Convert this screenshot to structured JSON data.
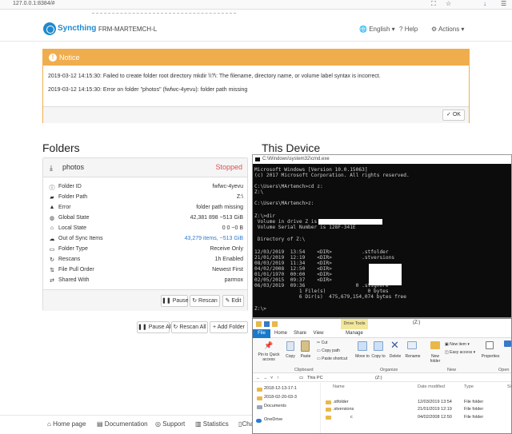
{
  "browser": {
    "url": "127.0.0.1:8384/#"
  },
  "navbar": {
    "brand": "Syncthing",
    "device_name": "FRM-MARTEMCH-L",
    "language": "English",
    "help": "Help",
    "actions": "Actions"
  },
  "notice": {
    "title": "Notice",
    "messages": [
      "2019-03-12 14:15:30: Failed to create folder root directory mkdir \\\\?\\: The filename, directory name, or volume label syntax is incorrect.",
      "2019-03-12 14:15:30: Error on folder \"photos\" (fwfwc-4yevu): folder path missing"
    ],
    "ok_label": "OK"
  },
  "folders": {
    "heading": "Folders",
    "folder": {
      "name": "photos",
      "state": "Stopped",
      "rows": [
        {
          "icon": "info-icon",
          "label": "Folder ID",
          "value": "fwfwc-4yevu"
        },
        {
          "icon": "folder-icon",
          "label": "Folder Path",
          "value": "Z:\\"
        },
        {
          "icon": "warning-icon",
          "label": "Error",
          "value": "folder path missing"
        },
        {
          "icon": "globe-icon",
          "label": "Global State",
          "value": "42,381   898   ~513 GiB"
        },
        {
          "icon": "home-icon",
          "label": "Local State",
          "value": "0   0   ~0 B"
        },
        {
          "icon": "cloud-icon",
          "label": "Out of Sync Items",
          "value": "43,279 items, ~513 GiB"
        },
        {
          "icon": "folder-type-icon",
          "label": "Folder Type",
          "value": "Receive Only"
        },
        {
          "icon": "refresh-icon",
          "label": "Rescans",
          "value": "1h   Enabled"
        },
        {
          "icon": "sort-icon",
          "label": "File Pull Order",
          "value": "Newest First"
        },
        {
          "icon": "share-icon",
          "label": "Shared With",
          "value": "parmox"
        }
      ],
      "buttons": {
        "pause": "Pause",
        "rescan": "Rescan",
        "edit": "Edit"
      }
    },
    "global_buttons": {
      "pause_all": "Pause All",
      "rescan_all": "Rescan All",
      "add_folder": "Add Folder"
    }
  },
  "this_device": {
    "heading": "This Device"
  },
  "footer": {
    "home": "Home page",
    "docs": "Documentation",
    "support": "Support",
    "stats": "Statistics",
    "changelog": "Cha"
  },
  "cmd": {
    "title": "C:\\Windows\\system32\\cmd.exe",
    "lines": [
      "Microsoft Windows [Version 10.0.15063]",
      "(c) 2017 Microsoft Corporation. All rights reserved.",
      "",
      "C:\\Users\\MArtemch>cd z:",
      "Z:\\",
      "",
      "C:\\Users\\MArtemch>z:",
      "",
      "Z:\\>dir",
      " Volume in drive Z is",
      " Volume Serial Number is 128F-341E",
      "",
      " Directory of Z:\\",
      "",
      "12/03/2019  13:54    <DIR>          .stfolder",
      "21/01/2019  12:19    <DIR>          .stversions",
      "08/03/2019  11:34    <DIR>",
      "04/02/2008  12:50    <DIR>",
      "01/01/1970  00:00    <DIR>",
      "02/05/2015  09:37    <DIR>",
      "06/03/2019  09:36                 0 .stignore",
      "               1 File(s)              0 bytes",
      "               6 Dir(s)  475,679,154,074 bytes free",
      "",
      "Z:\\>"
    ]
  },
  "explorer": {
    "title": "(Z:)",
    "drive_tools": "Drive Tools",
    "tabs": [
      "File",
      "Home",
      "Share",
      "View",
      "Manage"
    ],
    "ribbon": {
      "pin": "Pin to Quick access",
      "copy": "Copy",
      "paste": "Paste",
      "cut": "Cut",
      "copy_path": "Copy path",
      "paste_shortcut": "Paste shortcut",
      "move_to": "Move to",
      "copy_to": "Copy to",
      "delete": "Delete",
      "rename": "Rename",
      "new_folder": "New folder",
      "new_item": "New item",
      "easy_access": "Easy access",
      "properties": "Properties",
      "groups": [
        "Clipboard",
        "Organize",
        "New",
        "Open"
      ]
    },
    "address": {
      "this_pc": "This PC",
      "drive": "(Z:)"
    },
    "nav": [
      "2018-12-13-17-1",
      "2018-02-20-03-3",
      "Documents",
      "OneDrive"
    ],
    "columns": [
      "Name",
      "Date modified",
      "Type",
      "Si"
    ],
    "rows": [
      {
        "name": ".stfolder",
        "date": "12/03/2019 13:54",
        "type": "File folder"
      },
      {
        "name": ".stversions",
        "date": "21/01/2019 12:19",
        "type": "File folder"
      },
      {
        "name": "c",
        "date": "04/02/2008 12:50",
        "type": "File folder"
      }
    ]
  }
}
